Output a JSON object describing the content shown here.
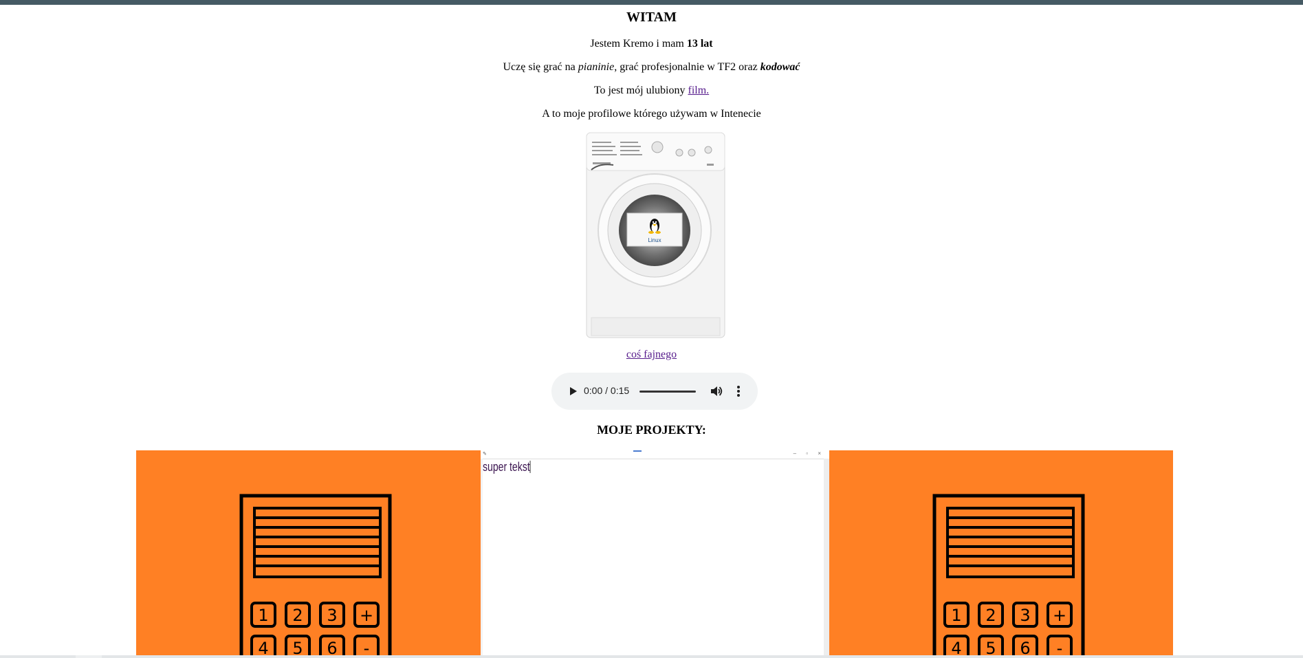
{
  "heading": "WITAM",
  "intro": {
    "prefix": "Jestem Kremo i mam ",
    "age": "13 lat"
  },
  "hobbies": {
    "part1": "Uczę się grać na ",
    "piano": "pianinie",
    "part2": ", grać profesjonalnie w TF2 oraz ",
    "coding": "kodować"
  },
  "movie": {
    "prefix": "To jest mój ulubiony ",
    "link": "film."
  },
  "avatar_caption": "A to moje profilowe którego używam w Intenecie",
  "avatar": {
    "logo_text": "Linux"
  },
  "cool_link": "coś fajnego",
  "audio": {
    "time": "0:00 / 0:15",
    "progress": 0,
    "icon_play": "play-icon",
    "icon_volume": "volume-icon",
    "icon_more": "more-vert-icon"
  },
  "projects_title": "MOJE PROJEKTY:",
  "projects": {
    "notepad_text": "super tekst",
    "calc_keys_row1": [
      "1",
      "2",
      "3",
      "+"
    ],
    "calc_keys_row2": [
      "4",
      "5",
      "6",
      "-"
    ]
  },
  "colors": {
    "topbar": "#455a64",
    "project_bg": "#ff8024",
    "link": "#551a8b"
  }
}
